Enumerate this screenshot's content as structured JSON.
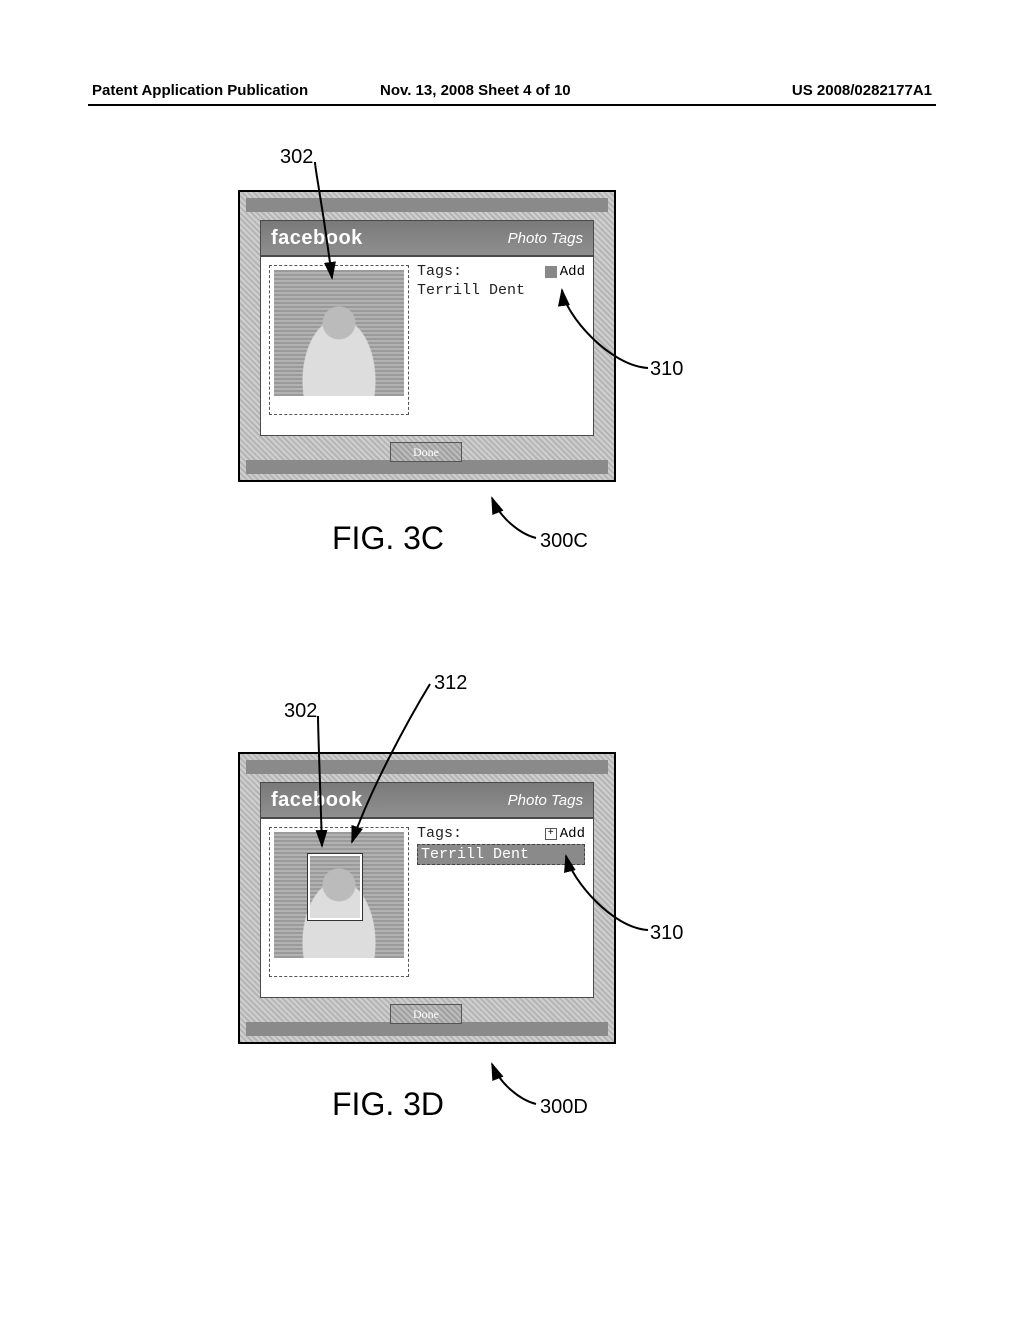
{
  "header": {
    "left": "Patent Application Publication",
    "center": "Nov. 13, 2008  Sheet 4 of 10",
    "right": "US 2008/0282177A1"
  },
  "figC": {
    "brand": "facebook",
    "section": "Photo Tags",
    "tags_label": "Tags:",
    "add_label": "Add",
    "tag_name": "Terrill Dent",
    "done": "Done",
    "caption": "FIG. 3C",
    "ref_302": "302",
    "ref_310": "310",
    "ref_300C": "300C"
  },
  "figD": {
    "brand": "facebook",
    "section": "Photo Tags",
    "tags_label": "Tags:",
    "add_label": "Add",
    "tag_name": "Terrill Dent",
    "done": "Done",
    "caption": "FIG. 3D",
    "ref_302": "302",
    "ref_312": "312",
    "ref_310": "310",
    "ref_300D": "300D"
  }
}
